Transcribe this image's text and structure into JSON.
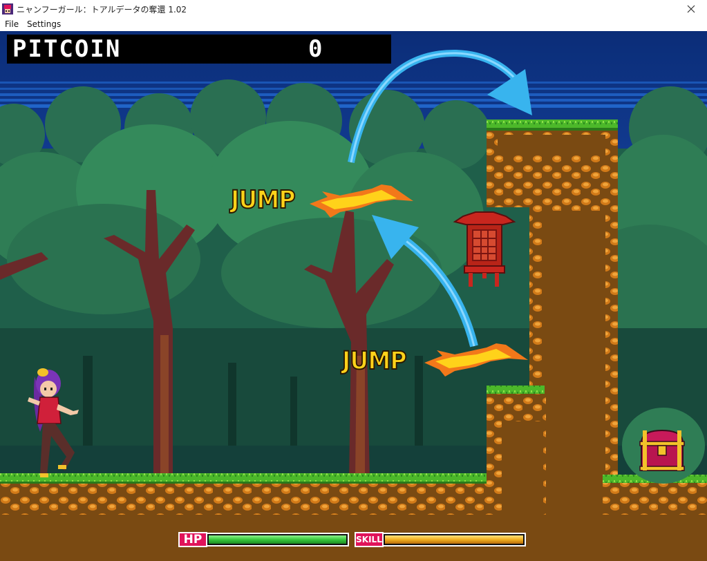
{
  "window": {
    "title": "ニャンフーガール：トアルデータの奪還 1.02",
    "icon": "game-app-icon",
    "close_icon": "close-icon"
  },
  "menu": {
    "items": [
      {
        "label": "File"
      },
      {
        "label": "Settings"
      }
    ]
  },
  "hud": {
    "coin_label": "PITCOIN",
    "coin_value": "0",
    "hp_label": "HP",
    "skill_label": "SKILL",
    "hp_fraction": 1.0,
    "skill_fraction": 1.0,
    "hp_color": "#38c83c",
    "skill_color": "#f0b020"
  },
  "tutorial": {
    "jump_upper": "JUMP",
    "jump_lower": "JUMP"
  },
  "colors": {
    "sky_top": "#0b2d78",
    "sky_band": "#1752b0",
    "forest_far": "#1f5f4a",
    "forest_near": "#2d7a4e",
    "grass": "#4cb82a",
    "dirt": "#7a4a12",
    "rock": "#d27a18",
    "arrow": "#38b4ee",
    "accent_pink": "#e0135a"
  },
  "sprites": {
    "player": "kung-fu-girl-player",
    "lantern": "red-lantern",
    "chest": "treasure-chest"
  }
}
